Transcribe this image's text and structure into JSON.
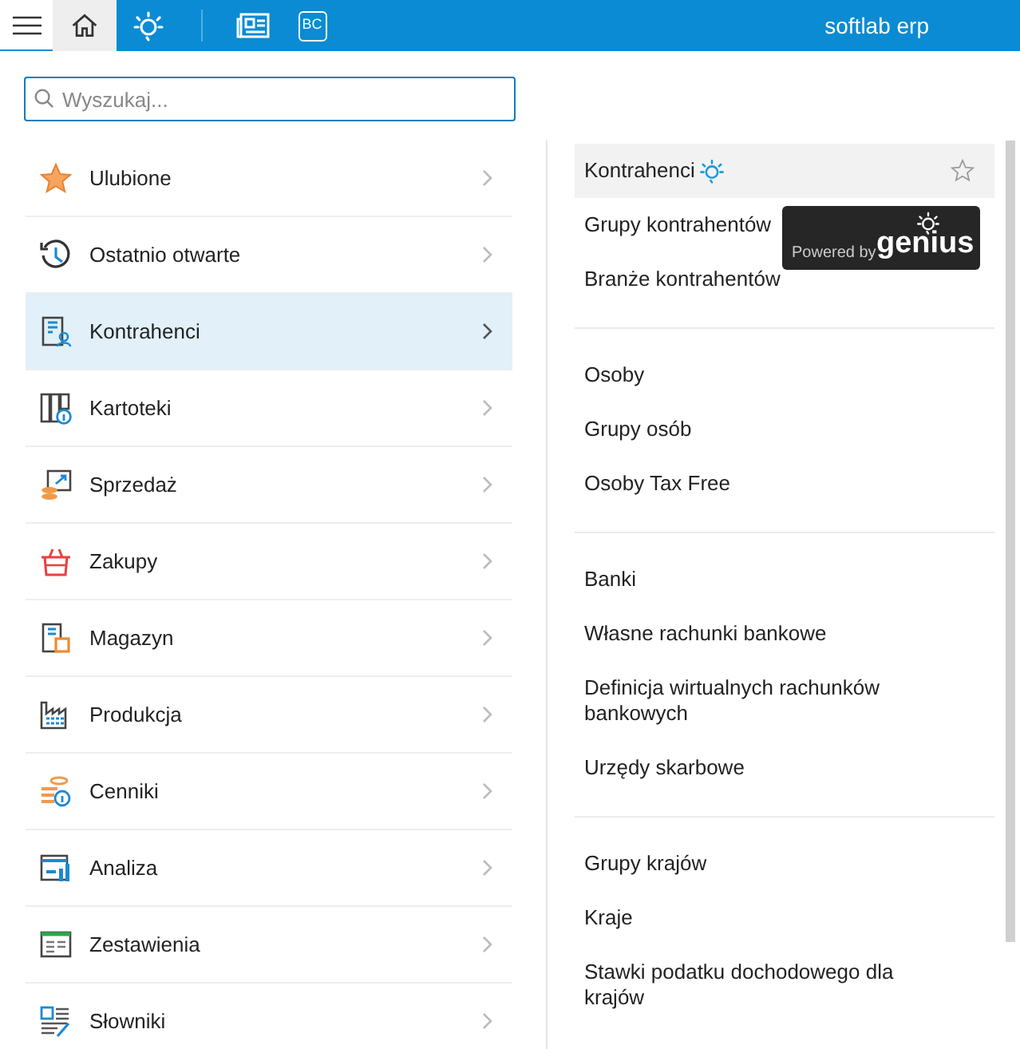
{
  "toolbar": {
    "tabs": [
      {
        "kind": "home",
        "selected": true
      },
      {
        "kind": "ideas",
        "selected": false
      }
    ],
    "tools": [
      {
        "kind": "news"
      },
      {
        "kind": "bc",
        "label": "BC"
      }
    ],
    "brand": "softlab erp"
  },
  "search": {
    "placeholder": "Wyszukaj..."
  },
  "menu": [
    {
      "label": "Ulubione",
      "kind": "star",
      "selected": false
    },
    {
      "label": "Ostatnio otwarte",
      "kind": "history",
      "selected": false
    },
    {
      "label": "Kontrahenci",
      "kind": "contractors",
      "selected": true
    },
    {
      "label": "Kartoteki",
      "kind": "files",
      "selected": false
    },
    {
      "label": "Sprzedaż",
      "kind": "sales",
      "selected": false
    },
    {
      "label": "Zakupy",
      "kind": "basket",
      "selected": false
    },
    {
      "label": "Magazyn",
      "kind": "warehouse",
      "selected": false
    },
    {
      "label": "Produkcja",
      "kind": "factory",
      "selected": false
    },
    {
      "label": "Cenniki",
      "kind": "coins",
      "selected": false
    },
    {
      "label": "Analiza",
      "kind": "analysis",
      "selected": false
    },
    {
      "label": "Zestawienia",
      "kind": "table",
      "selected": false
    },
    {
      "label": "Słowniki",
      "kind": "dictionary",
      "selected": false
    }
  ],
  "submenu": [
    {
      "items": [
        {
          "label": "Kontrahenci",
          "kind": "genius",
          "selected": true
        },
        {
          "label": "Grupy kontrahentów",
          "kind": "plain",
          "selected": false
        },
        {
          "label": "Branże kontrahentów",
          "kind": "plain",
          "selected": false
        }
      ]
    },
    {
      "items": [
        {
          "label": "Osoby",
          "kind": "plain",
          "selected": false
        },
        {
          "label": "Grupy osób",
          "kind": "plain",
          "selected": false
        },
        {
          "label": "Osoby Tax Free",
          "kind": "plain",
          "selected": false
        }
      ]
    },
    {
      "items": [
        {
          "label": "Banki",
          "kind": "plain",
          "selected": false
        },
        {
          "label": "Własne rachunki bankowe",
          "kind": "plain",
          "selected": false
        },
        {
          "label": "Definicja wirtualnych rachunków bankowych",
          "kind": "plain",
          "selected": false
        },
        {
          "label": "Urzędy skarbowe",
          "kind": "plain",
          "selected": false
        }
      ]
    },
    {
      "items": [
        {
          "label": "Grupy krajów",
          "kind": "plain",
          "selected": false
        },
        {
          "label": "Kraje",
          "kind": "plain",
          "selected": false
        },
        {
          "label": "Stawki podatku dochodowego dla krajów",
          "kind": "plain",
          "selected": false
        }
      ]
    }
  ],
  "tooltip": {
    "caption": "Powered by",
    "logo": "genius"
  }
}
